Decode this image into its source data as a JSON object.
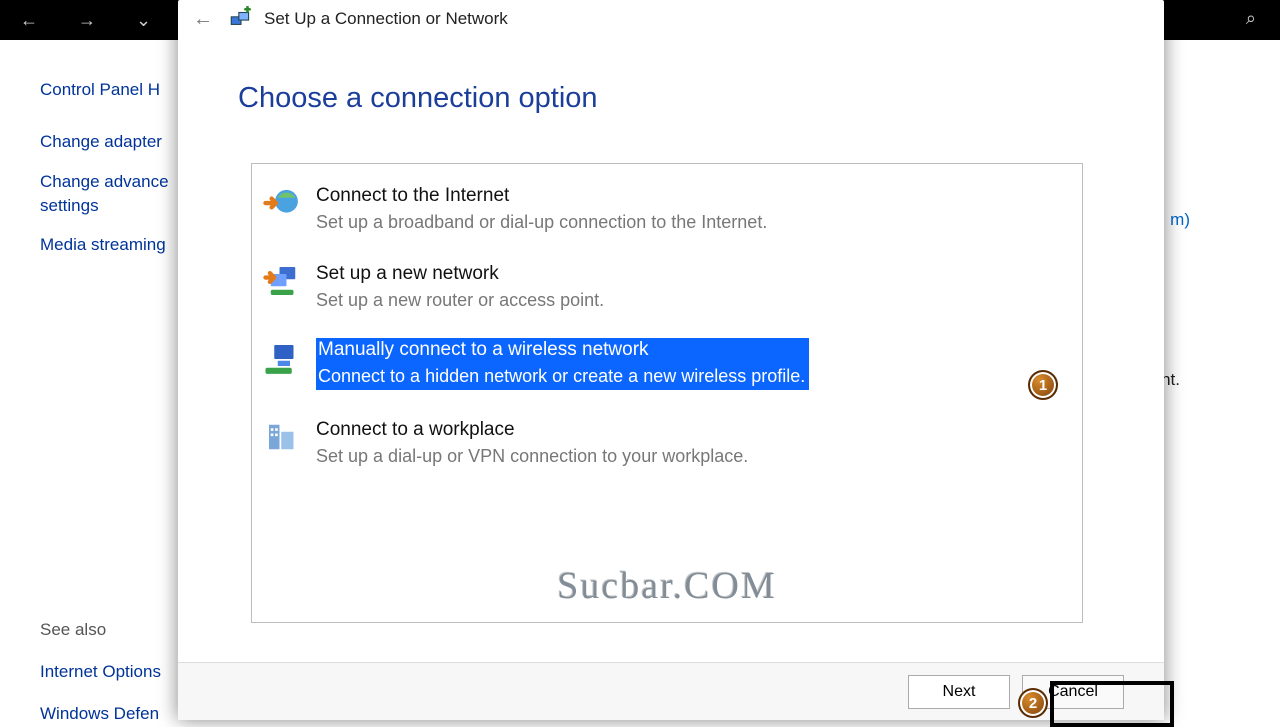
{
  "bg": {
    "title": "Control Panel H",
    "links": [
      "Change adapter",
      "Change advance\nsettings",
      "Media streaming"
    ],
    "see_also_label": "See also",
    "see_also_items": [
      "Internet Options",
      "Windows Defen"
    ],
    "right_link_fragment": "m)",
    "right_hint_fragment": "int."
  },
  "wizard": {
    "header_title": "Set Up a Connection or Network",
    "main_heading": "Choose a connection option",
    "options": [
      {
        "title": "Connect to the Internet",
        "desc": "Set up a broadband or dial-up connection to the Internet.",
        "icon": "globe-arrow-icon"
      },
      {
        "title": "Set up a new network",
        "desc": "Set up a new router or access point.",
        "icon": "router-icon"
      },
      {
        "title": "Manually connect to a wireless network",
        "desc": "Connect to a hidden network or create a new wireless profile.",
        "icon": "wireless-icon",
        "selected": true
      },
      {
        "title": "Connect to a workplace",
        "desc": "Set up a dial-up or VPN connection to your workplace.",
        "icon": "buildings-icon"
      }
    ],
    "watermark": "Sucbar.COM",
    "next_label": "Next",
    "cancel_label": "Cancel"
  },
  "annotations": {
    "badge1": "1",
    "badge2": "2"
  }
}
